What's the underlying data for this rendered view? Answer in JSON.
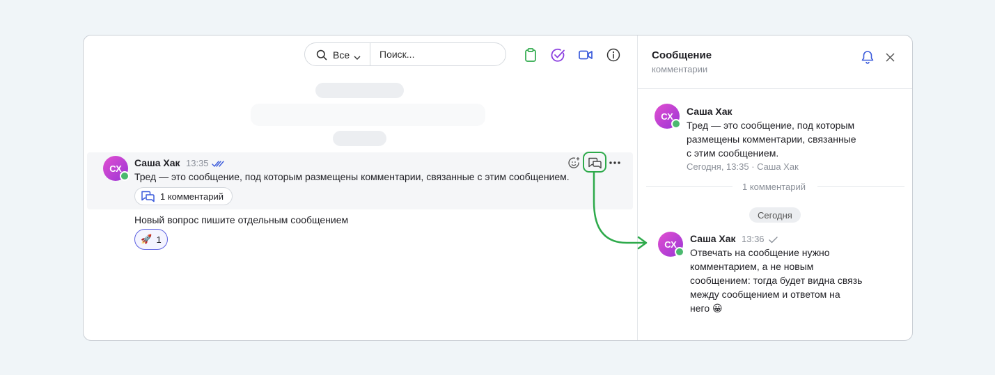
{
  "search": {
    "filter_label": "Все",
    "placeholder": "Поиск..."
  },
  "message": {
    "avatar_initials": "СХ",
    "author": "Саша Хак",
    "time": "13:35",
    "text": "Тред — это сообщение, под которым размещены комментарии, связанные с этим сообщением.",
    "thread_label": "1 комментарий"
  },
  "message2": {
    "text": "Новый вопрос пишите отдельным сообщением",
    "reaction_emoji": "🚀",
    "reaction_count": "1"
  },
  "panel": {
    "title": "Сообщение",
    "subtitle": "комментарии",
    "root": {
      "avatar_initials": "СХ",
      "author": "Саша Хак",
      "text_lines": [
        "Тред — это сообщение, под которым",
        "размещены комментарии, связанные",
        "с этим сообщением."
      ],
      "meta": "Сегодня, 13:35 · Саша Хак"
    },
    "comment_count": "1 комментарий",
    "date_separator": "Сегодня",
    "reply": {
      "avatar_initials": "СХ",
      "author": "Саша Хак",
      "time": "13:36",
      "text_lines": [
        "Отвечать на сообщение нужно",
        "комментарием, а не новым",
        "сообщением: тогда будет видна связь",
        "между сообщением и ответом на",
        "него 😀"
      ]
    }
  },
  "colors": {
    "accent_green": "#2eaa4b",
    "accent_blue": "#3b5bdb",
    "avatar_gradient_start": "#e24fd0",
    "avatar_gradient_end": "#9a35d6",
    "online": "#4bb96f"
  }
}
